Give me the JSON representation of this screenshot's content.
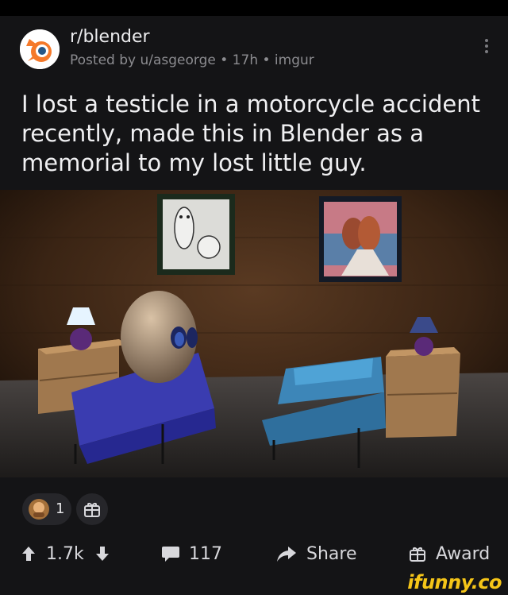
{
  "post": {
    "subreddit": "r/blender",
    "meta": "Posted by u/asgeorge • 17h • imgur",
    "title": "I lost a testicle in a motorcycle accident recently, made this in Blender as a memorial to my lost little guy."
  },
  "awards": {
    "count": "1"
  },
  "actions": {
    "upvotes": "1.7k",
    "comments": "117",
    "share": "Share",
    "award": "Award"
  },
  "watermark": "ifunny.co",
  "colors": {
    "background": "#141416",
    "blender_orange": "#f5792a",
    "blender_blue": "#265787",
    "watermark": "#f5c518"
  }
}
